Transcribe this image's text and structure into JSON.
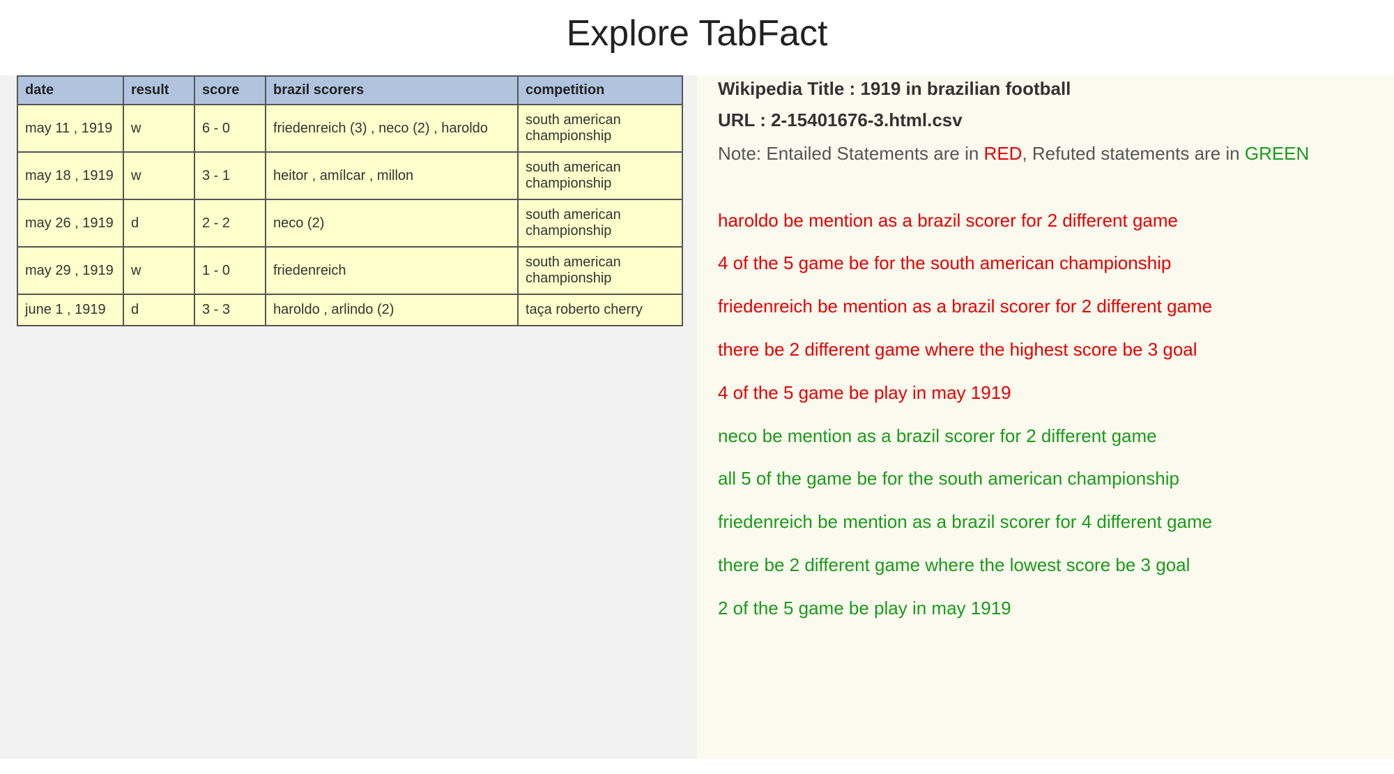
{
  "title": "Explore TabFact",
  "table": {
    "headers": [
      "date",
      "result",
      "score",
      "brazil scorers",
      "competition"
    ],
    "rows": [
      {
        "date": "may 11 , 1919",
        "result": "w",
        "score": "6 - 0",
        "scorers": "friedenreich (3) , neco (2) , haroldo",
        "competition": "south american championship"
      },
      {
        "date": "may 18 , 1919",
        "result": "w",
        "score": "3 - 1",
        "scorers": "heitor , amílcar , millon",
        "competition": "south american championship"
      },
      {
        "date": "may 26 , 1919",
        "result": "d",
        "score": "2 - 2",
        "scorers": "neco (2)",
        "competition": "south american championship"
      },
      {
        "date": "may 29 , 1919",
        "result": "w",
        "score": "1 - 0",
        "scorers": "friedenreich",
        "competition": "south american championship"
      },
      {
        "date": "june 1 , 1919",
        "result": "d",
        "score": "3 - 3",
        "scorers": "haroldo , arlindo (2)",
        "competition": "taça roberto cherry"
      }
    ]
  },
  "meta": {
    "wiki_label": "Wikipedia Title : ",
    "wiki_title": "1919 in brazilian football",
    "url_label": "URL : ",
    "url_value": "2-15401676-3.html.csv",
    "note_prefix": "Note: Entailed Statements are in ",
    "note_red": "RED",
    "note_mid": ", Refuted statements are in ",
    "note_green": "GREEN"
  },
  "statements": [
    {
      "text": "haroldo be mention as a brazil scorer for 2 different game",
      "kind": "entailed"
    },
    {
      "text": "4 of the 5 game be for the south american championship",
      "kind": "entailed"
    },
    {
      "text": "friedenreich be mention as a brazil scorer for 2 different game",
      "kind": "entailed"
    },
    {
      "text": "there be 2 different game where the highest score be 3 goal",
      "kind": "entailed"
    },
    {
      "text": "4 of the 5 game be play in may 1919",
      "kind": "entailed"
    },
    {
      "text": "neco be mention as a brazil scorer for 2 different game",
      "kind": "refuted"
    },
    {
      "text": "all 5 of the game be for the south american championship",
      "kind": "refuted"
    },
    {
      "text": "friedenreich be mention as a brazil scorer for 4 different game",
      "kind": "refuted"
    },
    {
      "text": "there be 2 different game where the lowest score be 3 goal",
      "kind": "refuted"
    },
    {
      "text": "2 of the 5 game be play in may 1919",
      "kind": "refuted"
    }
  ]
}
